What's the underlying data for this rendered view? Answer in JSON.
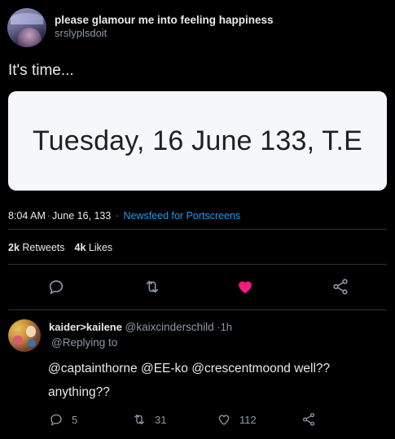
{
  "tweet": {
    "author_name": "please glamour me into feeling happiness",
    "author_handle": "srslyplsdoit",
    "text": "It's time...",
    "card_text": "Tuesday, 16 June 133, T.E",
    "time": "8:04 AM",
    "date": "June 16, 133",
    "source": "Newsfeed for Portscreens",
    "retweets_count": "2k",
    "retweets_label": "Retweets",
    "likes_count": "4k",
    "likes_label": "Likes",
    "liked": true
  },
  "reply": {
    "name": "kaider>kailene",
    "handle": "@kaixcinderschild",
    "time": "1h",
    "replying_to": "@Replying to",
    "text": "@captainthorne @EE-ko @crescentmoond well?? anything??",
    "reply_count": "5",
    "retweet_count": "31",
    "like_count": "112"
  },
  "icons": {
    "reply": "reply-icon",
    "retweet": "retweet-icon",
    "like": "heart-icon",
    "share": "share-icon"
  },
  "colors": {
    "background": "#000000",
    "link": "#1d9bf0",
    "like_active": "#f91880",
    "muted": "#8b98a5",
    "card_background": "#f5f7fb"
  }
}
